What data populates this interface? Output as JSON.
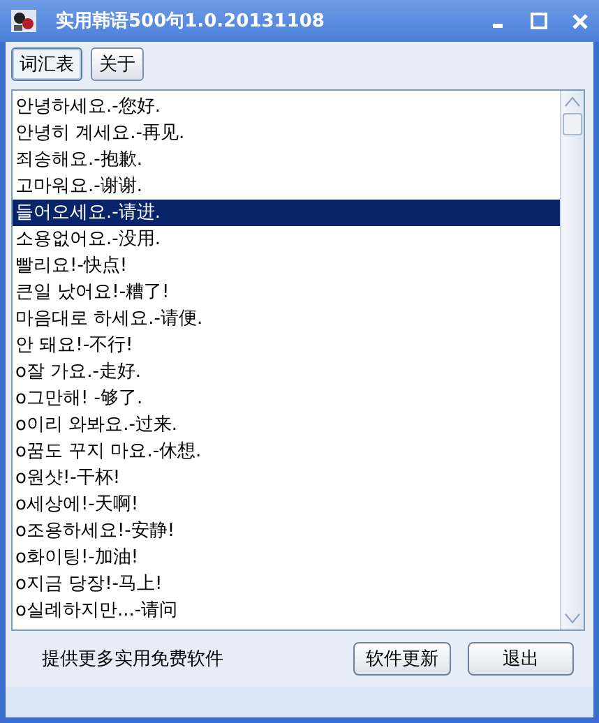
{
  "window": {
    "title": "实用韩语500句1.0.20131108"
  },
  "tabs": [
    {
      "label": "词汇表",
      "selected": true
    },
    {
      "label": "关于",
      "selected": false
    }
  ],
  "list": {
    "items": [
      {
        "text": "안녕하세요.-您好.",
        "selected": false
      },
      {
        "text": "안녕히 계세요.-再见.",
        "selected": false
      },
      {
        "text": "죄송해요.-抱歉.",
        "selected": false
      },
      {
        "text": "고마워요.-谢谢.",
        "selected": false
      },
      {
        "text": "들어오세요.-请进.",
        "selected": true
      },
      {
        "text": "소용없어요.-没用.",
        "selected": false
      },
      {
        "text": "빨리요!-快点!",
        "selected": false
      },
      {
        "text": "큰일 났어요!-糟了!",
        "selected": false
      },
      {
        "text": "마음대로 하세요.-请便.",
        "selected": false
      },
      {
        "text": "안 돼요!-不行!",
        "selected": false
      },
      {
        "text": "o잘 가요.-走好.",
        "selected": false
      },
      {
        "text": "o그만해! -够了.",
        "selected": false
      },
      {
        "text": "o이리 와봐요.-过来.",
        "selected": false
      },
      {
        "text": "o꿈도 꾸지 마요.-休想.",
        "selected": false
      },
      {
        "text": "o원샷!-干杯!",
        "selected": false
      },
      {
        "text": "o세상에!-天啊!",
        "selected": false
      },
      {
        "text": "o조용하세요!-安静!",
        "selected": false
      },
      {
        "text": "o화이팅!-加油!",
        "selected": false
      },
      {
        "text": "o지금 당장!-马上!",
        "selected": false
      },
      {
        "text": "o실례하지만...-请问",
        "selected": false
      }
    ]
  },
  "footer": {
    "note": "提供更多实用免费软件",
    "buttons": [
      "软件更新",
      "退出"
    ]
  }
}
